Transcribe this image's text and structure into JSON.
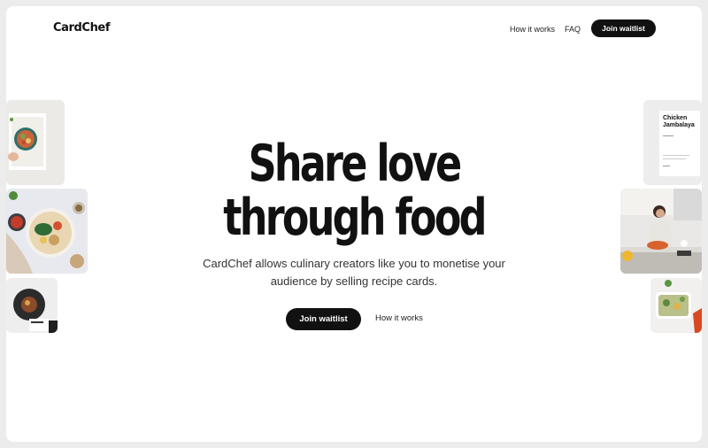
{
  "nav": {
    "logo": "CardChef",
    "links": [
      "How it works",
      "FAQ"
    ],
    "cta_label": "Join waitlist"
  },
  "hero": {
    "title_line1": "Share love",
    "title_line2": "through food",
    "subtitle": "CardChef allows culinary creators like you to monetise your audience by selling recipe cards.",
    "cta_label": "Join waitlist",
    "secondary_link": "How it works"
  },
  "tiles": {
    "recipe_card_title": "Chicken Jambalaya"
  },
  "colors": {
    "background": "#ffffff",
    "text": "#111111",
    "button": "#111111",
    "button_text": "#ffffff"
  }
}
